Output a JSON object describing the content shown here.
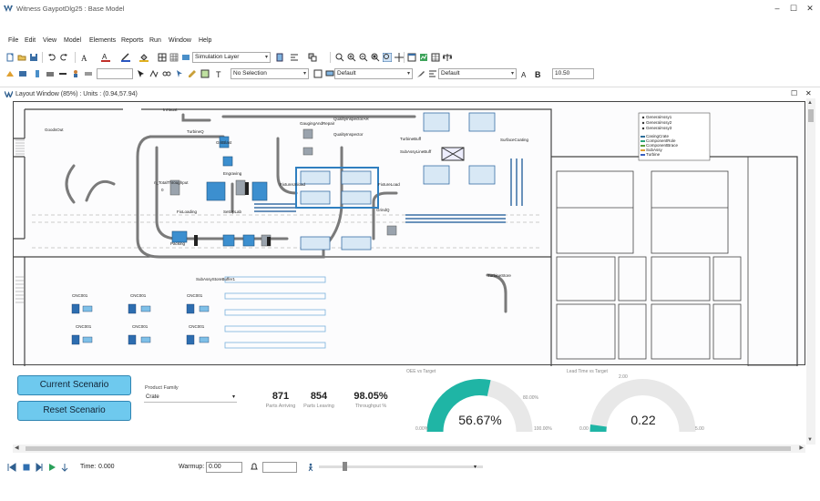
{
  "window": {
    "title": "Witness GaypotDlg25 : Base Model",
    "minimize": "–",
    "maximize": "☐",
    "close": "✕"
  },
  "menu": [
    "File",
    "Edit",
    "View",
    "Model",
    "Elements",
    "Reports",
    "Run",
    "Window",
    "Help"
  ],
  "toolbar": {
    "layer_select": "Simulation Layer",
    "selection_select": "No Selection",
    "style_select_1": "Default",
    "style_select_2": "Default",
    "size_value": "10.50"
  },
  "layout_window": {
    "title": "Layout Window (85%) : Units : (0.94,57.94)",
    "restore": "☐",
    "close": "✕"
  },
  "canvas_labels": {
    "goods_out": "GoodsOut",
    "surface_coating": "SurfaceCoating",
    "turbine_buff": "TurbineBuff",
    "subassy_line_buff": "SubAssyLineBuff",
    "quality_inspector_ar": "QualityInspectorAR",
    "quality_inspector": "QualityInspector",
    "gauging_and_repair": "GaugingAndRepair",
    "turbine_q": "TurbineQ",
    "grit_blast": "GritBlast",
    "engraving": "Engraving",
    "total_throughput": "n_TotalThroughput",
    "total_value": "0",
    "fix_loading": "FixLoading",
    "set_up_lab": "SetUpLab",
    "packing": "Packing",
    "fixture_unload": "FixtureUnload",
    "fixture_load": "FixtureLoad",
    "grind_q": "GrindQ",
    "subassy_store_buffer": "SubAssyStoreBuffer1",
    "turbine_store": "TurbineStore",
    "cnc": "CNC001",
    "inhaust": "InHaust"
  },
  "legend": {
    "assy_items": [
      "GeneralAssy1",
      "GeneralAssy2",
      "GeneralAssy3"
    ],
    "component_items": [
      "CasingCrate",
      "ComponentRole",
      "ComponentBrace",
      "SubAssy",
      "Turbine"
    ],
    "component_colors": [
      "#2f6f9a",
      "#2aa57a",
      "#5a9f3a",
      "#e0a030",
      "#3a5fbf"
    ]
  },
  "dashboard": {
    "current_scenario": "Current Scenario",
    "reset_scenario": "Reset Scenario",
    "product_family_label": "Product Family",
    "product_family_value": "Crate",
    "parts_arriving_value": "871",
    "parts_arriving_label": "Parts Arriving",
    "parts_leaving_value": "854",
    "parts_leaving_label": "Parts Leaving",
    "throughput_value": "98.05%",
    "throughput_label": "Throughput %",
    "gauge1": {
      "title": "OEE vs Target",
      "value_text": "56.67%",
      "value": 56.67,
      "min_label": "0.00%",
      "max_label": "100.00%",
      "target_label": "80.00%",
      "color": "#1fb5a5"
    },
    "gauge2": {
      "title": "Lead Time vs Target",
      "value_text": "0.22",
      "value": 0.22,
      "min_label": "0.00",
      "max_label": "5.00",
      "target_label": "2.00",
      "color": "#1fb5a5"
    }
  },
  "statusbar": {
    "time_label": "Time:",
    "time_value": "0.000",
    "warmup_label": "Warmup:",
    "warmup_value": "0.00"
  }
}
